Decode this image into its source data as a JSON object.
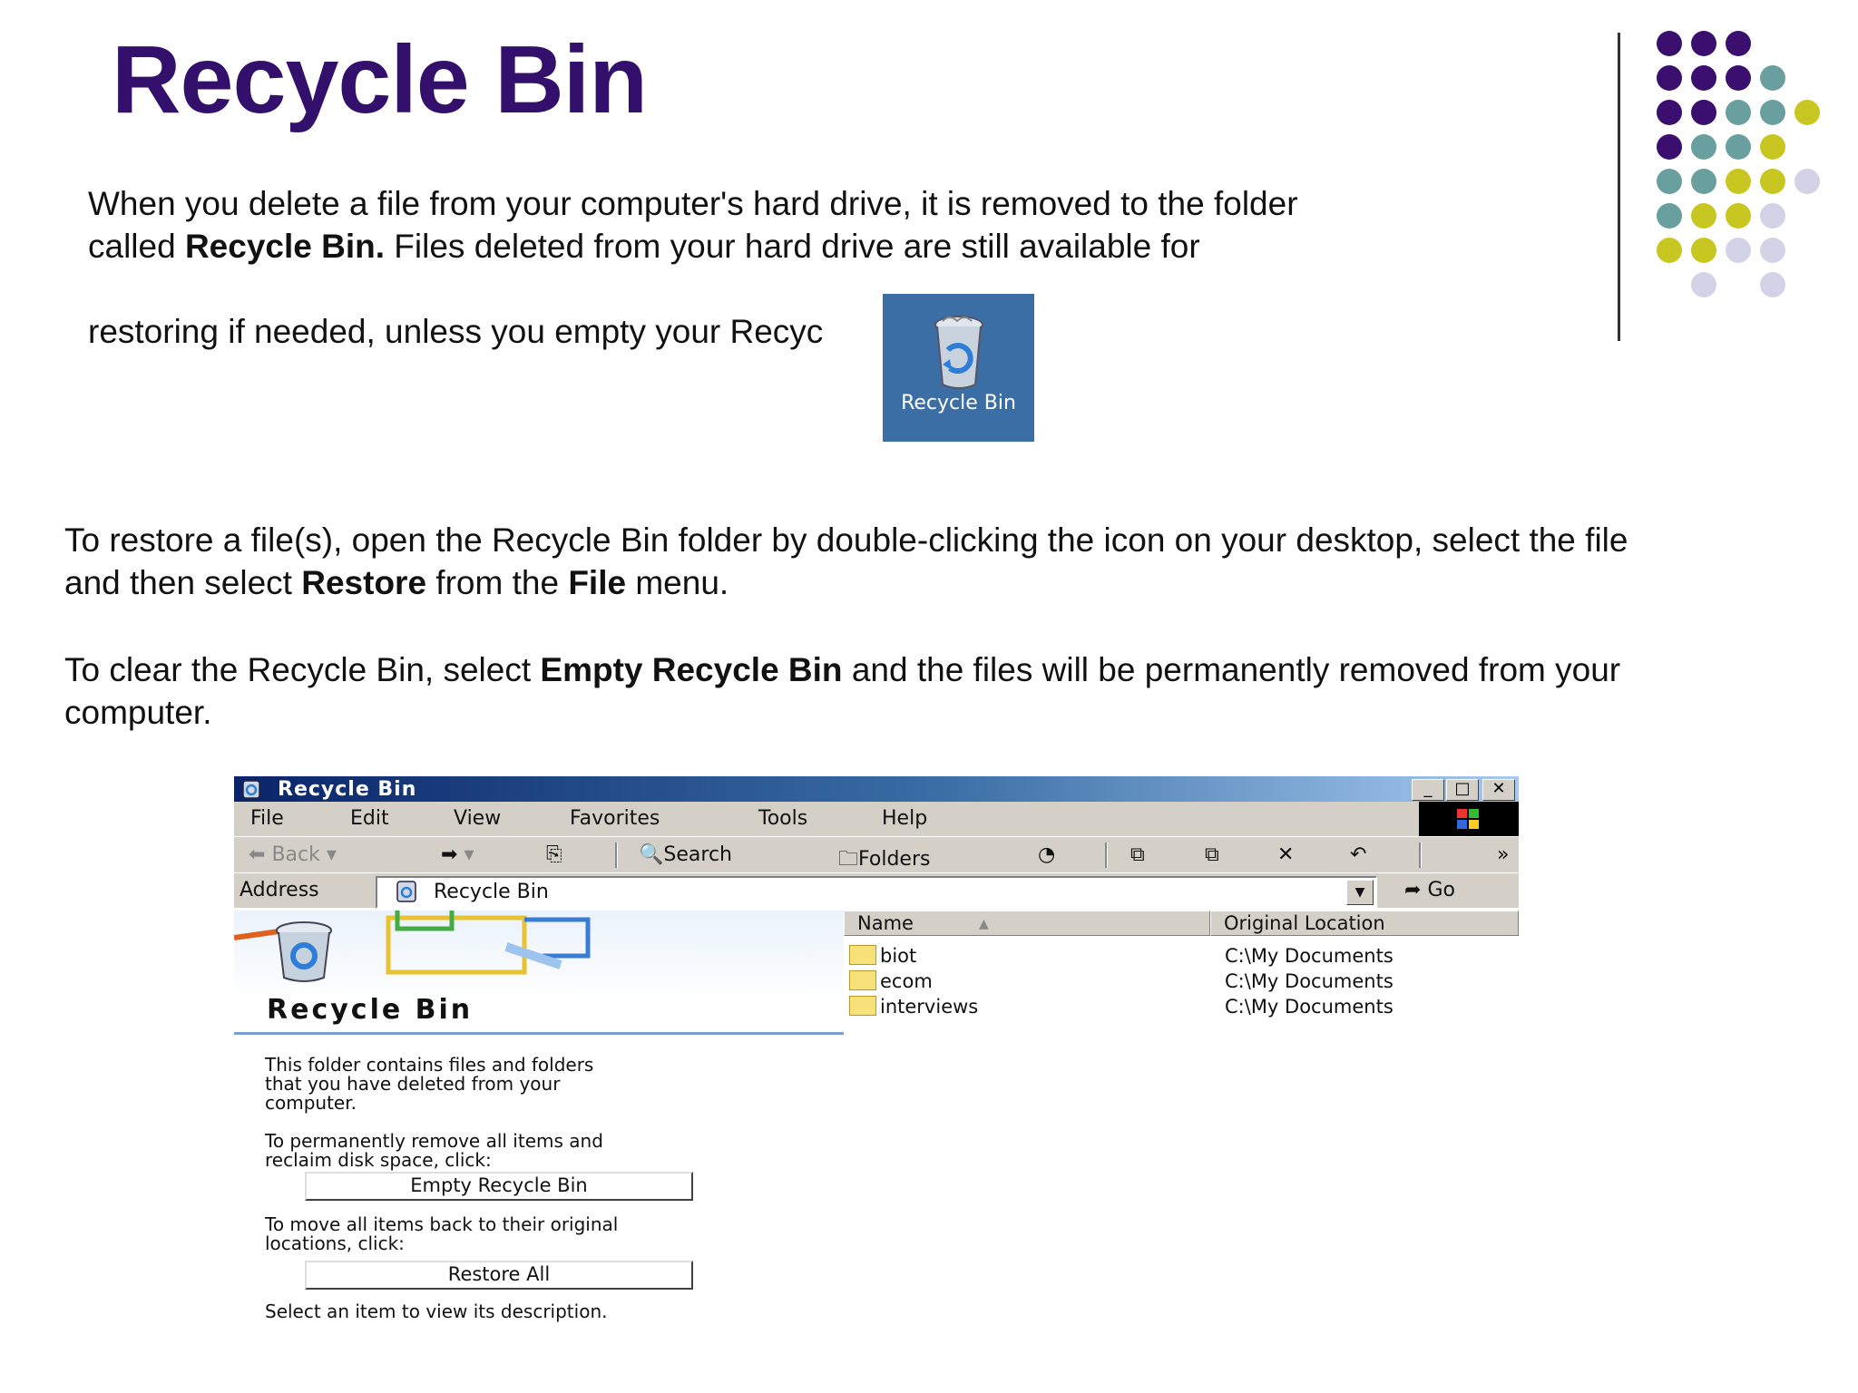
{
  "slide": {
    "title": "Recycle Bin",
    "intro_line1": "When you delete a file from your computer's hard drive, it is removed to the folder",
    "intro_line2_pre": "called ",
    "intro_line2_bold": "Recycle Bin.",
    "intro_line2_post": "  Files deleted from your hard drive are still available for",
    "intro_line3": "restoring if needed, unless you empty your Recyc",
    "desktop_icon_label": "Recycle Bin",
    "restore_line1": "To restore a file(s), open the Recycle Bin folder by double-clicking the icon on your desktop, select the file",
    "restore_line2_pre": "and then select ",
    "restore_bold1": "Restore",
    "restore_mid": " from the ",
    "restore_bold2": "File",
    "restore_post": " menu.",
    "clear_line1_pre": "To clear the Recycle Bin, select ",
    "clear_bold": "Empty Recycle Bin",
    "clear_line1_post": " and the files will be permanently removed from your",
    "clear_line2": "computer.",
    "colors": {
      "title": "#33106b",
      "purple": "#3a0f6e",
      "teal": "#6a9f9f",
      "olive": "#c8c620",
      "lavender": "#d4d2e6",
      "desktop": "#3b6ea5"
    }
  },
  "window": {
    "title": "Recycle Bin",
    "controls": [
      "_",
      "□",
      "✕"
    ],
    "menu": [
      "File",
      "Edit",
      "View",
      "Favorites",
      "Tools",
      "Help"
    ],
    "toolbar": {
      "back": "Back",
      "search": "Search",
      "folders": "Folders",
      "more": "»"
    },
    "address_label": "Address",
    "address_value": "Recycle Bin",
    "go_label": "Go",
    "left_pane": {
      "heading": "Recycle Bin",
      "desc1": "This folder contains files and folders",
      "desc2": "that you have deleted from your",
      "desc3": "computer.",
      "empty1": "To permanently remove all items and",
      "empty2": "reclaim disk space, click:",
      "empty_button": "Empty Recycle Bin",
      "restore1": "To move all items back to their original",
      "restore2": "locations, click:",
      "restore_button": "Restore All",
      "hint": "Select an item to view its description."
    },
    "columns": [
      "Name",
      "Original Location"
    ],
    "sort_indicator": "▲",
    "files": [
      {
        "name": "biot",
        "location": "C:\\My Documents"
      },
      {
        "name": "ecom",
        "location": "C:\\My Documents"
      },
      {
        "name": "interviews",
        "location": "C:\\My Documents"
      }
    ]
  },
  "icons": [
    "recycle-bin-icon",
    "back-arrow-icon",
    "forward-arrow-icon",
    "up-folder-icon",
    "search-icon",
    "folders-icon",
    "history-icon",
    "move-to-icon",
    "copy-to-icon",
    "delete-icon",
    "undo-icon",
    "go-arrow-icon",
    "folder-icon"
  ]
}
